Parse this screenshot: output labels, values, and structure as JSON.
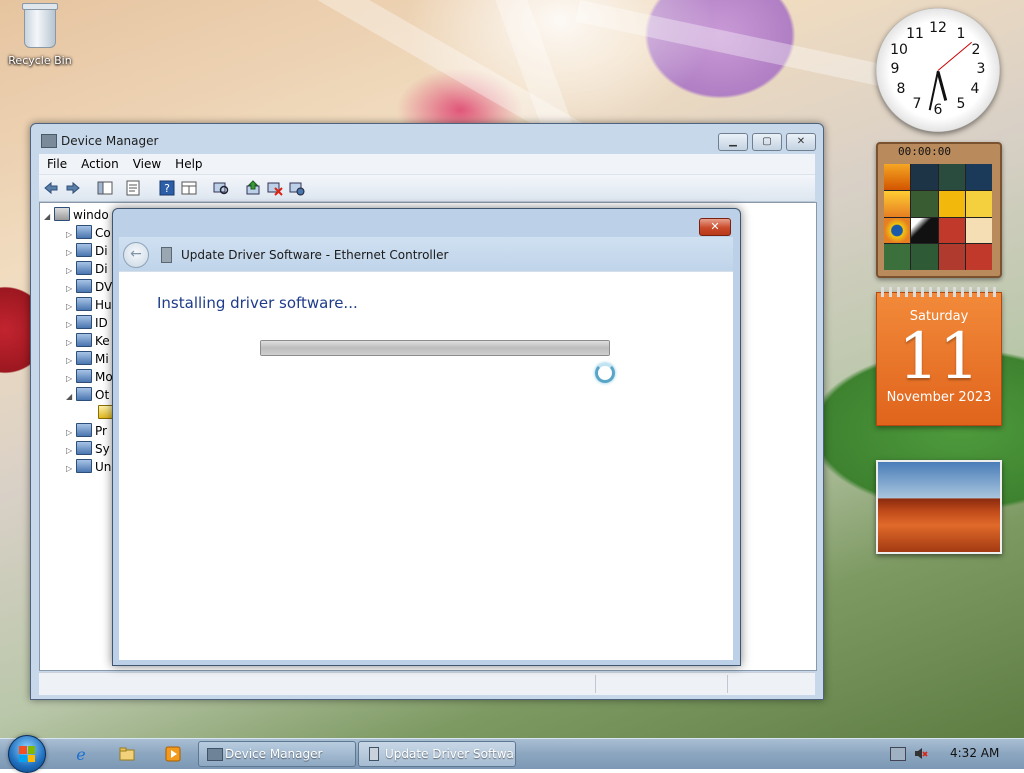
{
  "desktop": {
    "icons": [
      {
        "label": "Recycle Bin"
      }
    ]
  },
  "gadgets": {
    "clock": {
      "numbers": [
        "12",
        "1",
        "2",
        "3",
        "4",
        "5",
        "6",
        "7",
        "8",
        "9",
        "10",
        "11"
      ]
    },
    "puzzle": {
      "timer": "00:00:00"
    },
    "calendar": {
      "weekday": "Saturday",
      "day": "11",
      "month_year": "November 2023"
    }
  },
  "device_manager": {
    "title": "Device Manager",
    "menu": [
      "File",
      "Action",
      "View",
      "Help"
    ],
    "toolbar": [
      "back-icon",
      "forward-icon",
      "show-hide-tree-icon",
      "properties-icon",
      "help-icon",
      "view-icon",
      "scan-hardware-icon",
      "update-driver-icon",
      "uninstall-icon",
      "disable-icon"
    ],
    "tree": {
      "root": "windo",
      "items": [
        "Co",
        "Di",
        "Di",
        "DV",
        "Hu",
        "ID",
        "Ke",
        "Mi",
        "Mo",
        "Ot",
        "",
        "Pr",
        "Sy",
        "Un"
      ]
    }
  },
  "update_driver": {
    "title": "Update Driver Software - Ethernet Controller",
    "heading": "Installing driver software...",
    "progress": 1.0,
    "close_label": "✕"
  },
  "taskbar": {
    "tasks": [
      {
        "label": "Device Manager"
      },
      {
        "label": "Update Driver Softwa..."
      }
    ],
    "time": "4:32 AM"
  }
}
